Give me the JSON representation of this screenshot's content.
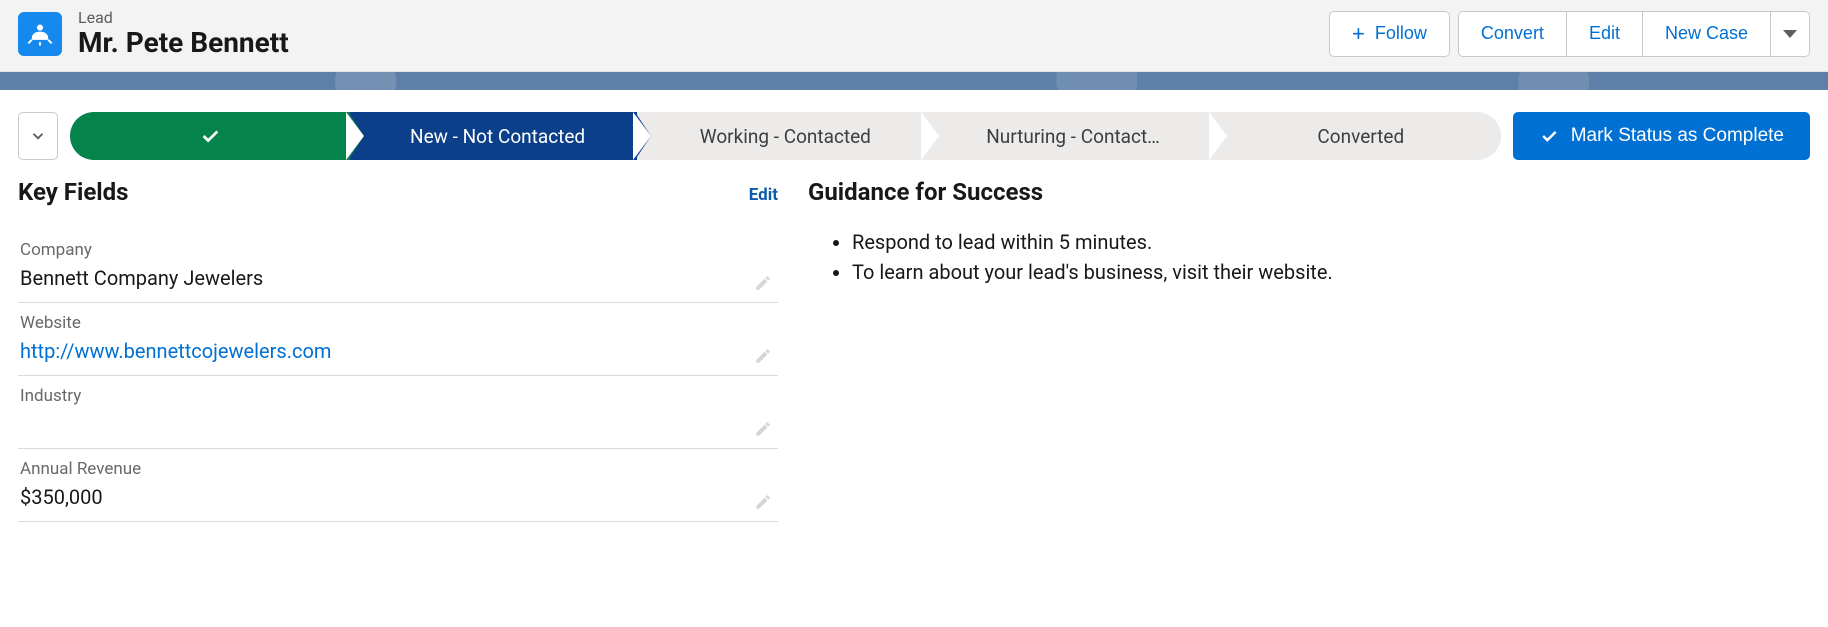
{
  "header": {
    "object_label": "Lead",
    "record_name": "Mr. Pete Bennett",
    "actions": {
      "follow": "Follow",
      "convert": "Convert",
      "edit": "Edit",
      "new_case": "New Case"
    }
  },
  "path": {
    "stages": [
      {
        "label": "",
        "state": "complete"
      },
      {
        "label": "New - Not Contacted",
        "state": "current"
      },
      {
        "label": "Working - Contacted",
        "state": "incomplete"
      },
      {
        "label": "Nurturing - Contact…",
        "state": "incomplete"
      },
      {
        "label": "Converted",
        "state": "incomplete"
      }
    ],
    "mark_complete_label": "Mark Status as Complete"
  },
  "key_fields": {
    "title": "Key Fields",
    "edit_label": "Edit",
    "items": [
      {
        "label": "Company",
        "value": "Bennett Company Jewelers",
        "is_link": false
      },
      {
        "label": "Website",
        "value": "http://www.bennettcojewelers.com",
        "is_link": true
      },
      {
        "label": "Industry",
        "value": "",
        "is_link": false
      },
      {
        "label": "Annual Revenue",
        "value": "$350,000",
        "is_link": false
      }
    ]
  },
  "guidance": {
    "title": "Guidance for Success",
    "items": [
      "Respond to lead within 5 minutes.",
      "To learn about your lead's business, visit their website."
    ]
  }
}
